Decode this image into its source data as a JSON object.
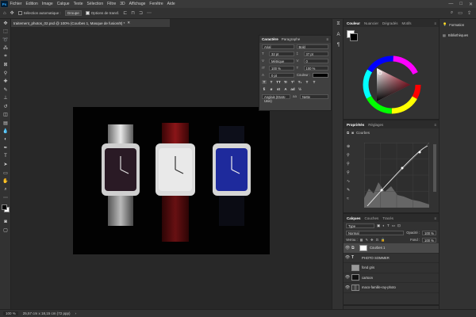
{
  "menubar": {
    "items": [
      "Fichier",
      "Edition",
      "Image",
      "Calque",
      "Texte",
      "Sélection",
      "Filtre",
      "3D",
      "Affichage",
      "Fenêtre",
      "Aide"
    ]
  },
  "options": {
    "auto_select_label": "Sélection automatique :",
    "auto_select_value": "Groupe",
    "transform_label": "Options de transf."
  },
  "document": {
    "tab_title": "traitement_photos_02.psd @ 100% (Courbes 1, Masque de fusion/8) *"
  },
  "status": {
    "zoom": "100 %",
    "doc_info": "25,57 cm x 18,15 cm (72 ppp)"
  },
  "character_panel": {
    "tabs": [
      "Caractère",
      "Paragraphe"
    ],
    "font_family": "Arial",
    "font_style": "Bold",
    "font_size": "32 pt",
    "leading": "37 pt",
    "kerning": "Métrique",
    "tracking": "0",
    "vertical_scale": "100 %",
    "horizontal_scale": "100 %",
    "baseline_shift": "0 pt",
    "color_label": "Couleur :",
    "language": "Anglais (Etats-Unis)",
    "antialias": "Nette",
    "type_buttons": [
      "T",
      "T",
      "TT",
      "Tr",
      "T¹",
      "T₁",
      "T",
      "T"
    ]
  },
  "color_panel": {
    "tabs": [
      "Couleur",
      "Nuancier",
      "Dégradés",
      "Motifs"
    ]
  },
  "properties_panel": {
    "tabs": [
      "Propriétés",
      "Réglages"
    ],
    "curves_label": "Courbes"
  },
  "layers_panel": {
    "tabs": [
      "Calques",
      "Couches",
      "Tracés"
    ],
    "kind_filter": "Type",
    "blend_mode": "Normal",
    "opacity_label": "Opacité :",
    "opacity_value": "100 %",
    "lock_label": "Verrou :",
    "fill_label": "Fond :",
    "fill_value": "100 %",
    "layers": [
      {
        "name": "Courbes 1",
        "selected": true
      },
      {
        "name": "PHOTO SOMMER",
        "selected": false
      },
      {
        "name": "fond gris",
        "selected": false
      },
      {
        "name": "cartoon",
        "selected": false
      },
      {
        "name": "maco-famille-ray-photo",
        "selected": false
      }
    ]
  },
  "learn_panel": {
    "items": [
      "Formation",
      "Bibliothèques"
    ]
  },
  "colors": {
    "accent": "#31a8ff",
    "watch_face_1": "#2a1a25",
    "watch_face_3": "#1e2a9c",
    "strap_red": "#7a0f12"
  }
}
